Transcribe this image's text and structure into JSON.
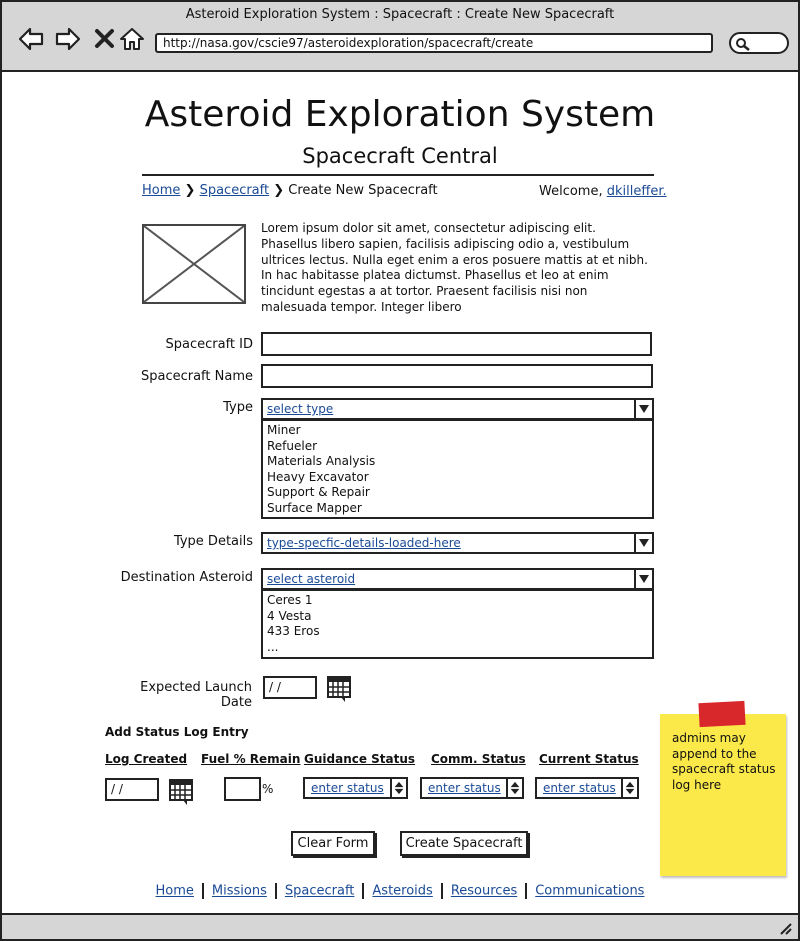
{
  "window": {
    "title": "Asteroid Exploration System : Spacecraft : Create New Spacecraft",
    "url": "http://nasa.gov/cscie97/asteroidexploration/spacecraft/create"
  },
  "header": {
    "title": "Asteroid Exploration System",
    "subtitle": "Spacecraft Central"
  },
  "breadcrumb": {
    "home": "Home",
    "spacecraft": "Spacecraft",
    "current": "Create New Spacecraft",
    "separator": "❯"
  },
  "user": {
    "welcome": "Welcome,",
    "name": "dkilleffer."
  },
  "intro": "Lorem ipsum dolor sit amet, consectetur adipiscing elit. Phasellus libero sapien, facilisis adipiscing odio a, vestibulum ultrices lectus. Nulla eget enim a eros posuere mattis at et nibh. In hac habitasse platea dictumst. Phasellus et leo at enim tincidunt egestas a at tortor. Praesent facilisis nisi non malesuada tempor. Integer libero",
  "form": {
    "spacecraft_id_label": "Spacecraft ID",
    "spacecraft_id_value": "",
    "spacecraft_name_label": "Spacecraft Name",
    "spacecraft_name_value": "",
    "type_label": "Type",
    "type_selected": "select type",
    "type_options": [
      "Miner",
      "Refueler",
      "Materials Analysis",
      "Heavy Excavator",
      "Support & Repair",
      "Surface Mapper"
    ],
    "type_details_label": "Type Details",
    "type_details_selected": "type-specfic-details-loaded-here",
    "destination_label": "Destination Asteroid",
    "destination_selected": "select asteroid",
    "destination_options": [
      "Ceres 1",
      "4 Vesta",
      "433 Eros",
      "..."
    ],
    "launch_label": "Expected Launch Date",
    "launch_value": "/ /"
  },
  "status_log": {
    "heading": "Add Status Log Entry",
    "columns": {
      "log_created": "Log Created",
      "fuel": "Fuel % Remain",
      "guidance": "Guidance Status",
      "comm": "Comm. Status",
      "current": "Current Status"
    },
    "log_created_value": "/ /",
    "fuel_value": "",
    "percent": "%",
    "guidance_value": "enter status",
    "comm_value": "enter status",
    "current_value": "enter status"
  },
  "buttons": {
    "clear": "Clear Form",
    "create": "Create Spacecraft"
  },
  "note": "admins may append to the spacecraft status log here",
  "footer_nav": [
    "Home",
    "Missions",
    "Spacecraft",
    "Asteroids",
    "Resources",
    "Communications"
  ]
}
